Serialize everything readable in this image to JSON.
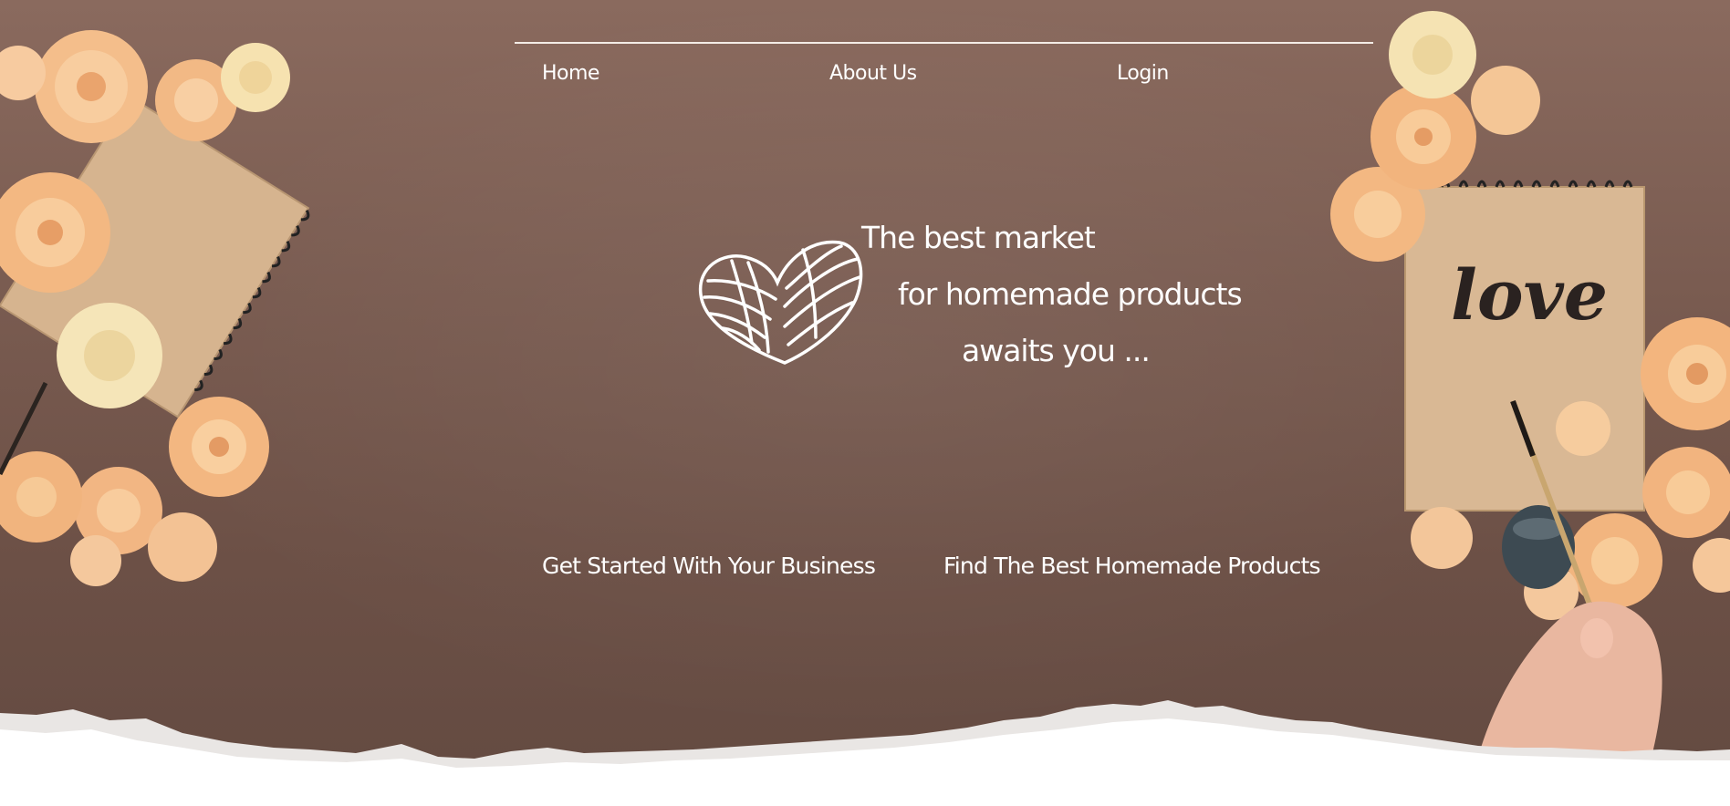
{
  "nav": {
    "items": [
      {
        "label": "Home"
      },
      {
        "label": "About Us"
      },
      {
        "label": "Login"
      }
    ]
  },
  "hero": {
    "tagline_line1": "The best market",
    "tagline_line2": "for homemade products",
    "tagline_line3": "awaits you ...",
    "logo_icon": "yarn-heart-icon"
  },
  "cta": {
    "business_label": "Get Started With Your Business",
    "products_label": "Find The Best Homemade Products"
  },
  "colors": {
    "background": "#7a5c51",
    "text": "#ffffff",
    "rose": "#f6c08f",
    "paper": "#d9b894"
  },
  "notebook": {
    "lettering": "love"
  }
}
